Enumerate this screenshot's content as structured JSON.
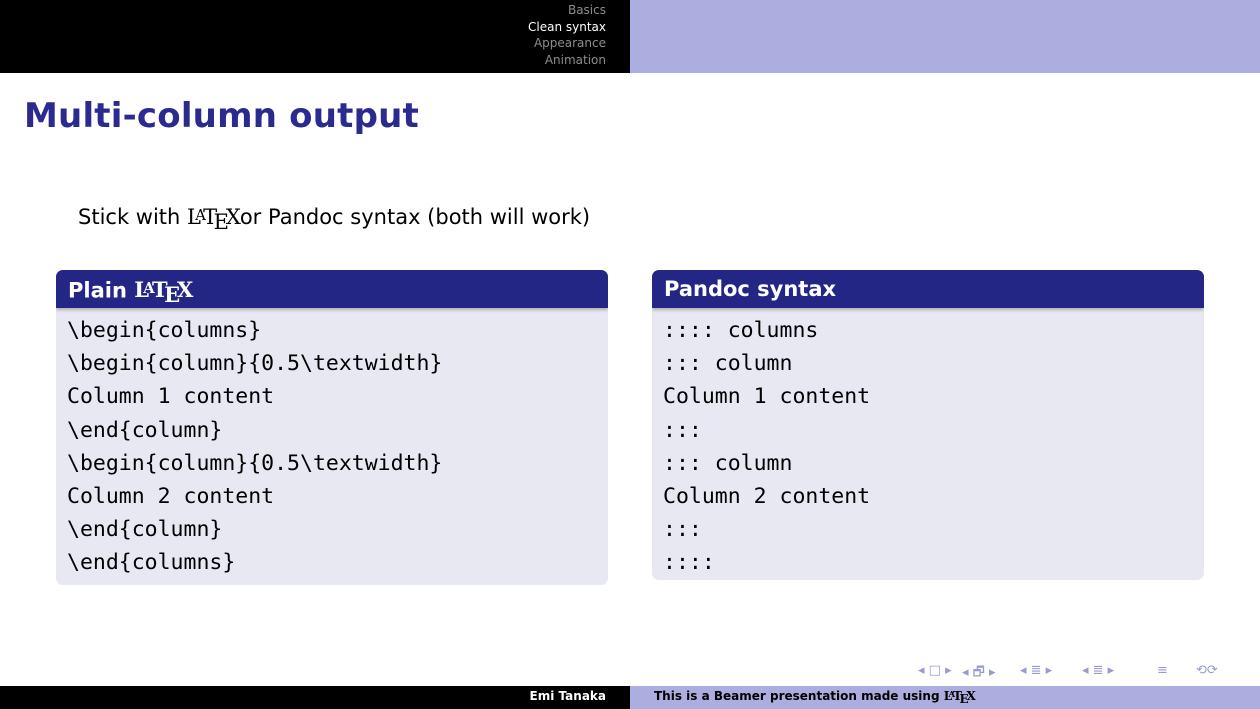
{
  "nav": {
    "sections": [
      "Basics",
      "Clean syntax",
      "Appearance",
      "Animation"
    ],
    "active_index": 1
  },
  "slide": {
    "title": "Multi-column output",
    "intro_before": "Stick with ",
    "intro_after": "or Pandoc syntax (both will work)"
  },
  "left_block": {
    "title_prefix": "Plain ",
    "lines": [
      "\\begin{columns}",
      "\\begin{column}{0.5\\textwidth}",
      "Column 1 content",
      "\\end{column}",
      "\\begin{column}{0.5\\textwidth}",
      "Column 2 content",
      "\\end{column}",
      "\\end{columns}"
    ]
  },
  "right_block": {
    "title": "Pandoc syntax",
    "lines": [
      ":::: columns",
      "::: column",
      "Column 1 content",
      ":::",
      "::: column",
      "Column 2 content",
      ":::",
      "::::"
    ]
  },
  "logo": {
    "l": "L",
    "a": "A",
    "t": "T",
    "e": "E",
    "x": "X"
  },
  "nav_symbols": [
    "◂ □ ▸",
    "◂ 🗗 ▸",
    "◂ ≣ ▸",
    "◂ ≣ ▸",
    "≡",
    "⟲⟳"
  ],
  "footer": {
    "author": "Emi Tanaka",
    "note_prefix": "This is a Beamer presentation made using "
  },
  "colors": {
    "title": "#2a2a8f",
    "block_header": "#242685",
    "block_body": "#e8e8f3",
    "header_right": "#abaedf",
    "header_left": "#000000"
  }
}
